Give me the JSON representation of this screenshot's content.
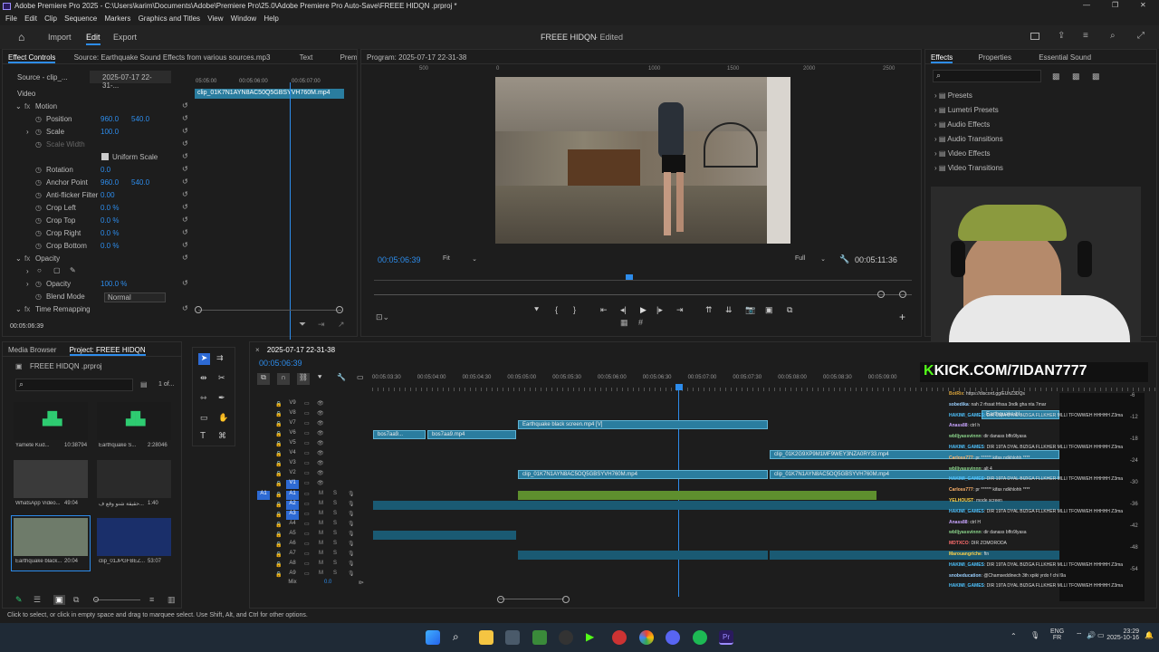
{
  "app": {
    "title": "Adobe Premiere Pro 2025 - C:\\Users\\karim\\Documents\\Adobe\\Premiere Pro\\25.0\\Adobe Premiere Pro Auto-Save\\FREEE HIDQN .prproj *"
  },
  "menu": [
    "File",
    "Edit",
    "Clip",
    "Sequence",
    "Markers",
    "Graphics and Titles",
    "View",
    "Window",
    "Help"
  ],
  "workspace": {
    "tabs": [
      "Import",
      "Edit",
      "Export"
    ],
    "project_title": "FREEE HIDQN",
    "status": "- Edited"
  },
  "effect_controls": {
    "tabs": [
      "Effect Controls",
      "Source: Earthquake Sound Effects from various sources.mp3",
      "Text",
      "Premiere I"
    ],
    "source_clip": "Source - clip_...",
    "sequence": "2025-07-17 22-31-...",
    "ruler": [
      "05:05:00",
      "00:05:06:00",
      "00:05:07:00"
    ],
    "clip_name": "clip_01K7N1AYN8AC50Q5GBSYVH760M.mp4",
    "video_label": "Video",
    "props": [
      {
        "name": "Motion",
        "v1": "",
        "v2": ""
      },
      {
        "name": "Position",
        "v1": "960.0",
        "v2": "540.0"
      },
      {
        "name": "Scale",
        "v1": "100.0",
        "v2": ""
      },
      {
        "name": "Scale Width",
        "v1": "",
        "v2": ""
      },
      {
        "name": "Uniform Scale",
        "v1": "",
        "v2": ""
      },
      {
        "name": "Rotation",
        "v1": "0.0",
        "v2": ""
      },
      {
        "name": "Anchor Point",
        "v1": "960.0",
        "v2": "540.0"
      },
      {
        "name": "Anti-flicker Filter",
        "v1": "0.00",
        "v2": ""
      },
      {
        "name": "Crop Left",
        "v1": "0.0 %",
        "v2": ""
      },
      {
        "name": "Crop Top",
        "v1": "0.0 %",
        "v2": ""
      },
      {
        "name": "Crop Right",
        "v1": "0.0 %",
        "v2": ""
      },
      {
        "name": "Crop Bottom",
        "v1": "0.0 %",
        "v2": ""
      },
      {
        "name": "Opacity",
        "v1": "",
        "v2": ""
      },
      {
        "name": "",
        "v1": "",
        "v2": ""
      },
      {
        "name": "Opacity",
        "v1": "100.0 %",
        "v2": ""
      },
      {
        "name": "Blend Mode",
        "v1": "Normal",
        "v2": ""
      },
      {
        "name": "Time Remapping",
        "v1": "",
        "v2": ""
      }
    ],
    "timecode": "00:05:06:39"
  },
  "program": {
    "title": "Program: 2025-07-17 22-31-38",
    "ruler": [
      "500",
      "0",
      "1000",
      "1500",
      "2000",
      "2500"
    ],
    "timecode": "00:05:06:39",
    "fit": "Fit",
    "quality": "Full",
    "duration": "00:05:11:36"
  },
  "effects": {
    "tabs": [
      "Effects",
      "Properties",
      "Essential Sound"
    ],
    "items": [
      "Presets",
      "Lumetri Presets",
      "Audio Effects",
      "Audio Transitions",
      "Video Effects",
      "Video Transitions"
    ]
  },
  "project": {
    "tabs": [
      "Media Browser",
      "Project: FREEE HIDQN"
    ],
    "file": "FREEE HIDQN .prproj",
    "count": "1 of...",
    "items": [
      {
        "name": "Yamete Kud...",
        "dur": "10:38794"
      },
      {
        "name": "Earthquake S...",
        "dur": "2:28046"
      },
      {
        "name": "WhatsApp Video...",
        "dur": "49:04"
      },
      {
        "name": "حقيقة شنو وقع ف...",
        "dur": "1:40"
      },
      {
        "name": "Earthquake black...",
        "dur": "20:04"
      },
      {
        "name": "clip_01JPGFBEZ...",
        "dur": "53:07"
      }
    ]
  },
  "timeline": {
    "title": "2025-07-17 22-31-38",
    "timecode": "00:05:06:39",
    "ruler": [
      "00:05:03:30",
      "00:05:04:00",
      "00:05:04:30",
      "00:05:05:00",
      "00:05:05:30",
      "00:05:06:00",
      "00:05:06:30",
      "00:05:07:00",
      "00:05:07:30",
      "00:05:08:00",
      "00:05:08:30",
      "00:05:09:00"
    ],
    "tracks": [
      "V9",
      "V8",
      "V7",
      "V6",
      "V5",
      "V4",
      "V3",
      "V2",
      "V1",
      "A1",
      "A2",
      "A3",
      "A4",
      "A5",
      "A6",
      "A7",
      "A8",
      "A9",
      "Mix"
    ],
    "mix_value": "0.0",
    "src_a1": "A1",
    "clips": {
      "earthquake": "Earthquake black screen.mp4 [V]",
      "bos1": "bos7aa9...",
      "bos2": "bos7aa9.mp4",
      "clip_v4": "clip_01K2G9XP9M1MF9WEY3NZA0RY33.mp4",
      "clip_v2a": "clip_01K7N1AYN8AC5OQ5GBSYVH760M.mp4",
      "clip_v2b": "clip_01K7N1AYN8AC5OQ5GBSYVH760M.mp4",
      "earthquake2": "Earthquake bl..."
    },
    "levels": [
      "-6",
      "-12",
      "-18",
      "-24",
      "-30",
      "-36",
      "-42",
      "-48",
      "-54"
    ]
  },
  "chat": [
    {
      "u": "BotRix",
      "m": ": https://discord.gg/EUhZ3DQs"
    },
    {
      "u": "sobedika",
      "m": ": nah 2 rfssat frfssa 3ndk gha nta 7mar"
    },
    {
      "u": "HAKIMI_GAMES",
      "m": ": DIR 19TA DYAL BIZIGA FLLKHER MLLI TFOWWEH HHHHH Z3ma"
    },
    {
      "u": "Anass88",
      "m": ": ctrl h"
    },
    {
      "u": "wblljyassvinnn",
      "m": ": dir danass bffo9lyasa"
    },
    {
      "u": "HAKIMI_GAMES",
      "m": ": DIR 19TA DYAL BIZIGA FLLKHER MLLI TFOWWEH HHHHH Z3ma"
    },
    {
      "u": "Carloss777",
      "m": ": pr ****** kifax ndkhlohh ****"
    },
    {
      "u": "wblljyassvinnn",
      "m": ": alt 4"
    },
    {
      "u": "HAKIMI_GAMES",
      "m": ": DIR 19TA DYAL BIZIGA FLLKHER MLLI TFOWWEH HHHHH Z3ma"
    },
    {
      "u": "Carloss777",
      "m": ": pr ****** kifax ndkhlohh ****"
    },
    {
      "u": "YELHOUST",
      "m": ": mode screen"
    },
    {
      "u": "HAKIMI_GAMES",
      "m": ": DIR 19TA DYAL BIZIGA FLLKHER MLLI TFOWWEH HHHHH Z3ma"
    },
    {
      "u": "Anass88",
      "m": ": ctrl H"
    },
    {
      "u": "wblljyassvinnn",
      "m": ": dir danass bffo9lyasa"
    },
    {
      "u": "MDTXCO",
      "m": ": DIR ZOMORODA"
    },
    {
      "u": "Marouangriche",
      "m": ": ftn"
    },
    {
      "u": "HAKIMI_GAMES",
      "m": ": DIR 19TA DYAL BIZIGA FLLKHER MLLI TFOWWEH HHHHH Z3ma"
    },
    {
      "u": "snobeducation",
      "m": ": @Chamseddinech 3th xpiki yrdo f chi l9a"
    },
    {
      "u": "HAKIMI_GAMES",
      "m": ": DIR 19TA DYAL BIZIGA FLLKHER MLLI TFOWWEH HHHHH Z3ma"
    }
  ],
  "overlay": {
    "kick": "KICK.COM/7IDAN7777"
  },
  "status": {
    "hint": "Click to select, or click in empty space and drag to marquee select. Use Shift, Alt, and Ctrl for other options."
  },
  "taskbar": {
    "lang1": "ENG",
    "lang2": "FR",
    "time": "23:29",
    "date": "2025-10-16"
  }
}
